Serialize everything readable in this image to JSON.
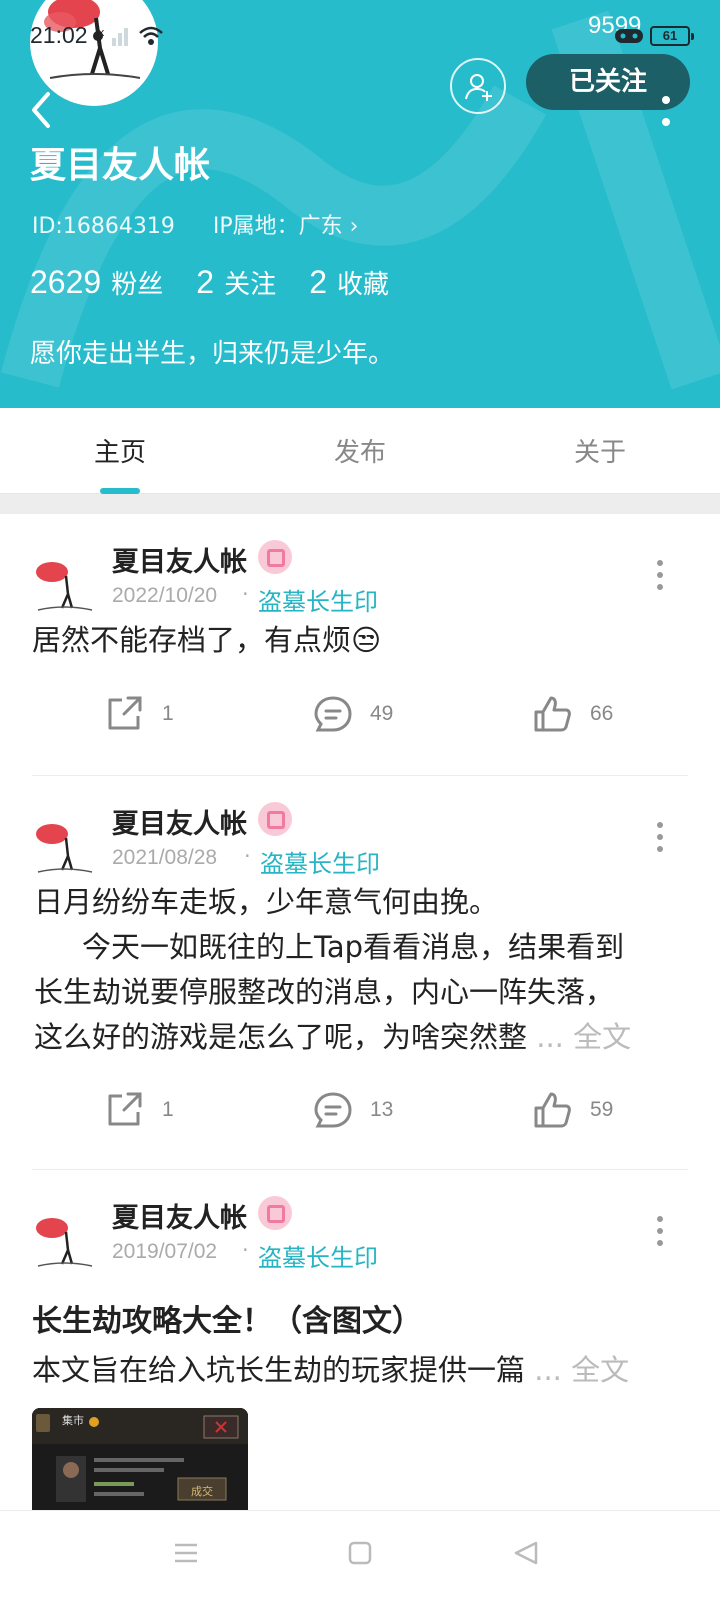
{
  "status_bar": {
    "time": "21:02",
    "top_number": "9599",
    "battery_level": "61"
  },
  "profile": {
    "username": "夏目友人帐",
    "follow_label": "已关注",
    "id_text": "ID:16864319",
    "ip_text": "IP属地：广东",
    "stats": [
      {
        "value": "2629",
        "label": "粉丝"
      },
      {
        "value": "2",
        "label": "关注"
      },
      {
        "value": "2",
        "label": "收藏"
      }
    ],
    "bio": "愿你走出半生，归来仍是少年。",
    "accent": "#26bccb"
  },
  "tabs": [
    {
      "label": "主页"
    },
    {
      "label": "发布"
    },
    {
      "label": "关于"
    }
  ],
  "posts": [
    {
      "author": "夏目友人帐",
      "date": "2022/10/20",
      "game": "盗墓长生印",
      "text": "居然不能存档了，有点烦😒",
      "shares": "1",
      "comments": "49",
      "likes": "66"
    },
    {
      "author": "夏目友人帐",
      "date": "2021/08/28",
      "game": "盗墓长生印",
      "line1": "日月纷纷车走坂，少年意气何由挽。",
      "line2": "今天一如既往的上Tap看看消息，结果看到",
      "line3": "长生劫说要停服整改的消息，内心一阵失落，",
      "line4": "这么好的游戏是怎么了呢，为啥突然整",
      "readmore": "... 全文",
      "shares": "1",
      "comments": "13",
      "likes": "59"
    },
    {
      "author": "夏目友人帐",
      "date": "2019/07/02",
      "game": "盗墓长生印",
      "title": "长生劫攻略大全！（含图文）",
      "text": "本文旨在给入坑长生劫的玩家提供一篇",
      "readmore": "... 全文",
      "thumb_title": "集市",
      "thumb_button": "成交"
    }
  ]
}
